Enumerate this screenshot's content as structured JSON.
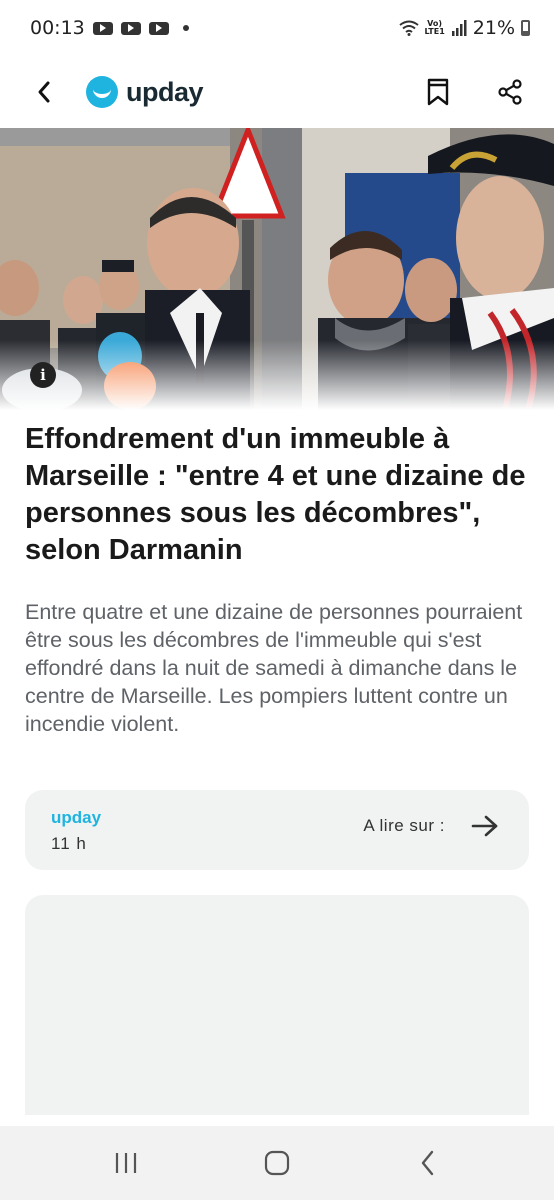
{
  "status_bar": {
    "time": "00:13",
    "battery": "21%",
    "network_top": "Vo)",
    "network_bottom": "LTE1"
  },
  "header": {
    "logo_text": "upday",
    "brand_color": "#1fb4e0"
  },
  "hero": {
    "info_label": "i"
  },
  "article": {
    "title": "Effondrement d'un immeuble à Marseille : \"entre 4 et une dizaine de personnes sous les décombres\", selon Darmanin",
    "summary": "Entre quatre et une dizaine de personnes pourraient être sous les décombres de l'immeuble qui s'est effondré dans la nuit de samedi à dimanche dans le centre de Marseille. Les pompiers luttent contre un incendie violent."
  },
  "source_card": {
    "source": "upday",
    "time": "11 h",
    "read_on": "A lire sur :"
  },
  "icons": {
    "back": "chevron-left-icon",
    "bookmark": "bookmark-icon",
    "share": "share-icon",
    "arrow": "arrow-right-icon",
    "nav_recents": "recents-icon",
    "nav_home": "home-icon",
    "nav_back": "back-icon"
  }
}
